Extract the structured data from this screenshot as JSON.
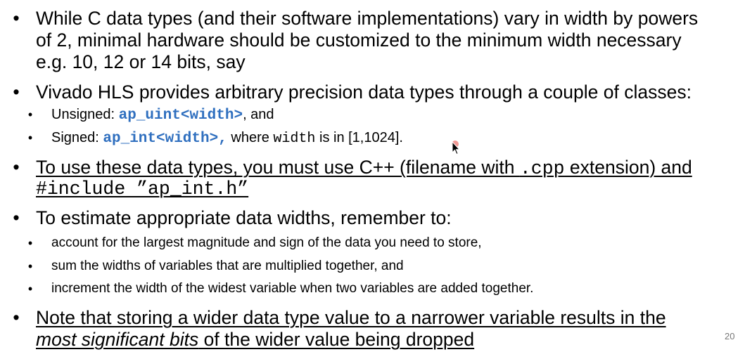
{
  "bullet_glyph": "•",
  "b1": {
    "line1": "While C data types (and their software implementations) vary in width by powers",
    "line2": "of 2, minimal hardware should be customized to the minimum width necessary",
    "line3": "e.g. 10, 12 or 14 bits, say"
  },
  "b2": {
    "text": "Vivado HLS provides arbitrary precision data types through a couple of classes:",
    "sub1": {
      "prefix": "Unsigned: ",
      "code": "ap_uint<width>",
      "suffix": ", and"
    },
    "sub2": {
      "prefix": "Signed: ",
      "code": "ap_int<width>,",
      "middle": " where ",
      "mono": "width",
      "suffix": " is in [1,1024]."
    }
  },
  "b3": {
    "part1": "To use these data types, you must use C++ (filename with ",
    "mono": ".cpp",
    "part2": " extension) and",
    "line2": "#include ”ap_int.h”"
  },
  "b4": {
    "text": "To estimate appropriate data widths, remember to:",
    "subs": [
      "account for the largest magnitude and sign of the data you need to store,",
      "sum the widths of variables that are multiplied together, and",
      "increment the width of the widest variable when two variables are added together."
    ]
  },
  "b5": {
    "line1": "Note that storing a wider data type value to a narrower variable results in the",
    "line2_italic": "most significant bits",
    "line2_rest": " of the wider value being dropped"
  },
  "page_number": "20",
  "colors": {
    "code_blue": "#2f6fbf",
    "text": "#000000",
    "page_number": "#777777",
    "cursor_highlight": "#e8463c"
  }
}
